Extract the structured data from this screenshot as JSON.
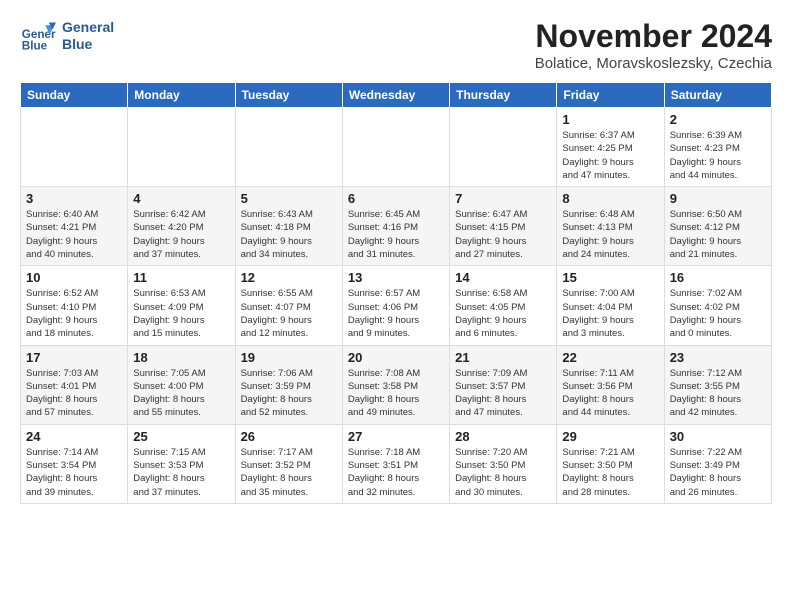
{
  "header": {
    "logo_line1": "General",
    "logo_line2": "Blue",
    "month": "November 2024",
    "location": "Bolatice, Moravskoslezsky, Czechia"
  },
  "weekdays": [
    "Sunday",
    "Monday",
    "Tuesday",
    "Wednesday",
    "Thursday",
    "Friday",
    "Saturday"
  ],
  "weeks": [
    [
      {
        "day": "",
        "info": ""
      },
      {
        "day": "",
        "info": ""
      },
      {
        "day": "",
        "info": ""
      },
      {
        "day": "",
        "info": ""
      },
      {
        "day": "",
        "info": ""
      },
      {
        "day": "1",
        "info": "Sunrise: 6:37 AM\nSunset: 4:25 PM\nDaylight: 9 hours\nand 47 minutes."
      },
      {
        "day": "2",
        "info": "Sunrise: 6:39 AM\nSunset: 4:23 PM\nDaylight: 9 hours\nand 44 minutes."
      }
    ],
    [
      {
        "day": "3",
        "info": "Sunrise: 6:40 AM\nSunset: 4:21 PM\nDaylight: 9 hours\nand 40 minutes."
      },
      {
        "day": "4",
        "info": "Sunrise: 6:42 AM\nSunset: 4:20 PM\nDaylight: 9 hours\nand 37 minutes."
      },
      {
        "day": "5",
        "info": "Sunrise: 6:43 AM\nSunset: 4:18 PM\nDaylight: 9 hours\nand 34 minutes."
      },
      {
        "day": "6",
        "info": "Sunrise: 6:45 AM\nSunset: 4:16 PM\nDaylight: 9 hours\nand 31 minutes."
      },
      {
        "day": "7",
        "info": "Sunrise: 6:47 AM\nSunset: 4:15 PM\nDaylight: 9 hours\nand 27 minutes."
      },
      {
        "day": "8",
        "info": "Sunrise: 6:48 AM\nSunset: 4:13 PM\nDaylight: 9 hours\nand 24 minutes."
      },
      {
        "day": "9",
        "info": "Sunrise: 6:50 AM\nSunset: 4:12 PM\nDaylight: 9 hours\nand 21 minutes."
      }
    ],
    [
      {
        "day": "10",
        "info": "Sunrise: 6:52 AM\nSunset: 4:10 PM\nDaylight: 9 hours\nand 18 minutes."
      },
      {
        "day": "11",
        "info": "Sunrise: 6:53 AM\nSunset: 4:09 PM\nDaylight: 9 hours\nand 15 minutes."
      },
      {
        "day": "12",
        "info": "Sunrise: 6:55 AM\nSunset: 4:07 PM\nDaylight: 9 hours\nand 12 minutes."
      },
      {
        "day": "13",
        "info": "Sunrise: 6:57 AM\nSunset: 4:06 PM\nDaylight: 9 hours\nand 9 minutes."
      },
      {
        "day": "14",
        "info": "Sunrise: 6:58 AM\nSunset: 4:05 PM\nDaylight: 9 hours\nand 6 minutes."
      },
      {
        "day": "15",
        "info": "Sunrise: 7:00 AM\nSunset: 4:04 PM\nDaylight: 9 hours\nand 3 minutes."
      },
      {
        "day": "16",
        "info": "Sunrise: 7:02 AM\nSunset: 4:02 PM\nDaylight: 9 hours\nand 0 minutes."
      }
    ],
    [
      {
        "day": "17",
        "info": "Sunrise: 7:03 AM\nSunset: 4:01 PM\nDaylight: 8 hours\nand 57 minutes."
      },
      {
        "day": "18",
        "info": "Sunrise: 7:05 AM\nSunset: 4:00 PM\nDaylight: 8 hours\nand 55 minutes."
      },
      {
        "day": "19",
        "info": "Sunrise: 7:06 AM\nSunset: 3:59 PM\nDaylight: 8 hours\nand 52 minutes."
      },
      {
        "day": "20",
        "info": "Sunrise: 7:08 AM\nSunset: 3:58 PM\nDaylight: 8 hours\nand 49 minutes."
      },
      {
        "day": "21",
        "info": "Sunrise: 7:09 AM\nSunset: 3:57 PM\nDaylight: 8 hours\nand 47 minutes."
      },
      {
        "day": "22",
        "info": "Sunrise: 7:11 AM\nSunset: 3:56 PM\nDaylight: 8 hours\nand 44 minutes."
      },
      {
        "day": "23",
        "info": "Sunrise: 7:12 AM\nSunset: 3:55 PM\nDaylight: 8 hours\nand 42 minutes."
      }
    ],
    [
      {
        "day": "24",
        "info": "Sunrise: 7:14 AM\nSunset: 3:54 PM\nDaylight: 8 hours\nand 39 minutes."
      },
      {
        "day": "25",
        "info": "Sunrise: 7:15 AM\nSunset: 3:53 PM\nDaylight: 8 hours\nand 37 minutes."
      },
      {
        "day": "26",
        "info": "Sunrise: 7:17 AM\nSunset: 3:52 PM\nDaylight: 8 hours\nand 35 minutes."
      },
      {
        "day": "27",
        "info": "Sunrise: 7:18 AM\nSunset: 3:51 PM\nDaylight: 8 hours\nand 32 minutes."
      },
      {
        "day": "28",
        "info": "Sunrise: 7:20 AM\nSunset: 3:50 PM\nDaylight: 8 hours\nand 30 minutes."
      },
      {
        "day": "29",
        "info": "Sunrise: 7:21 AM\nSunset: 3:50 PM\nDaylight: 8 hours\nand 28 minutes."
      },
      {
        "day": "30",
        "info": "Sunrise: 7:22 AM\nSunset: 3:49 PM\nDaylight: 8 hours\nand 26 minutes."
      }
    ]
  ]
}
